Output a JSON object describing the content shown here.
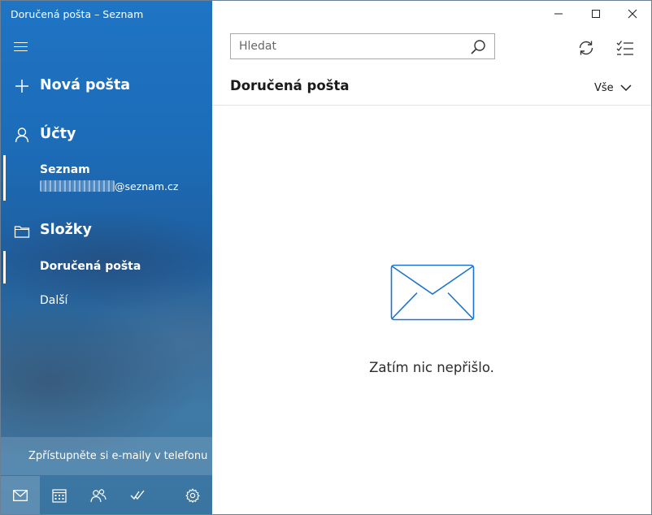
{
  "window": {
    "title": "Doručená pošta – Seznam"
  },
  "sidebar": {
    "new_mail": "Nová pošta",
    "accounts_label": "Účty",
    "account": {
      "name": "Seznam",
      "email_suffix": "@seznam.cz"
    },
    "folders_label": "Složky",
    "folders": [
      {
        "label": "Doručená pošta",
        "selected": true
      },
      {
        "label": "Další",
        "selected": false
      }
    ],
    "phone_promo": "Zpřístupněte si e-maily v telefonu",
    "bottom_icons": [
      "mail-icon",
      "calendar-icon",
      "people-icon",
      "todo-icon",
      "settings-icon"
    ]
  },
  "main": {
    "search": {
      "placeholder": "Hledat",
      "value": ""
    },
    "folder_title": "Doručená pošta",
    "filter": "Vše",
    "empty_message": "Zatím nic nepřišlo."
  },
  "colors": {
    "accent": "#1b75d0",
    "sidebar_top": "#1f74c4",
    "sidebar_bottom": "#3a74a0"
  }
}
